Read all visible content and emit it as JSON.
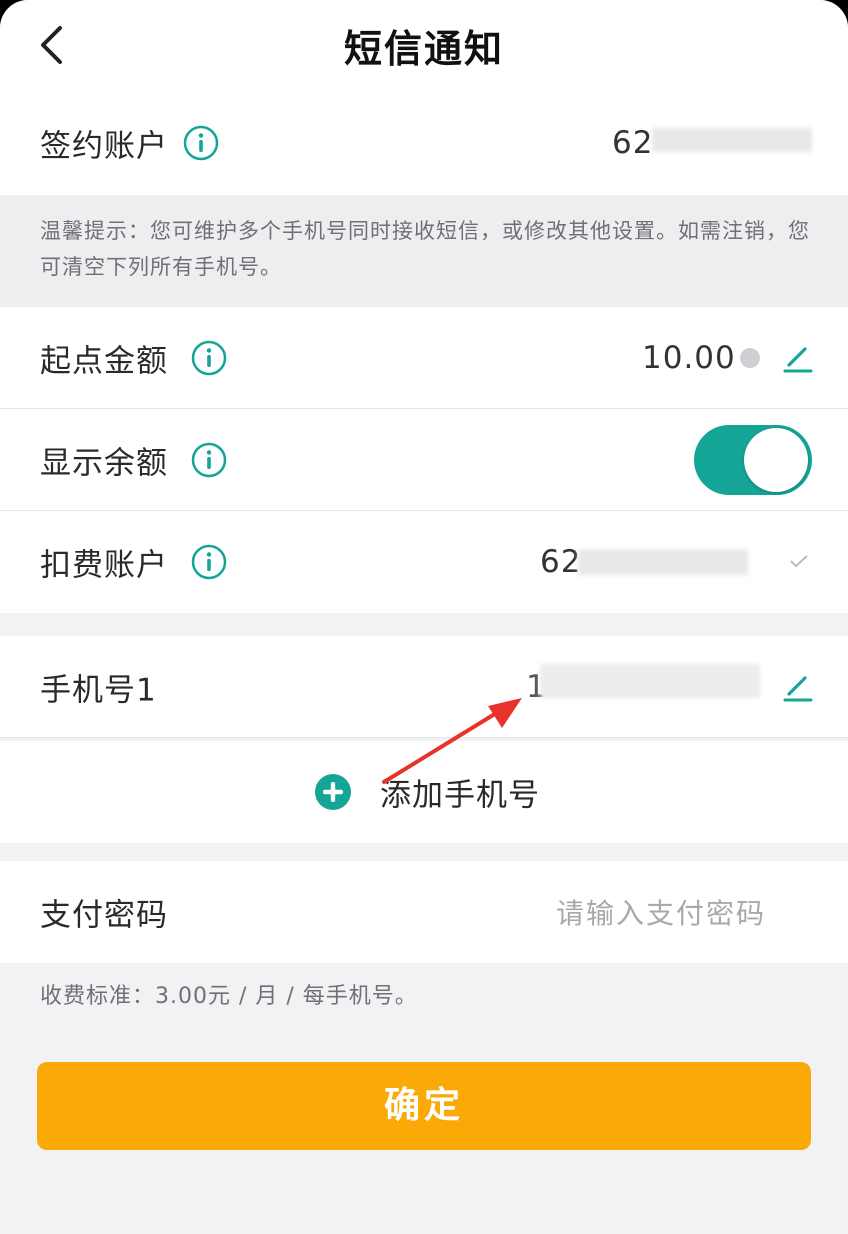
{
  "header": {
    "title": "短信通知"
  },
  "signing_account": {
    "label": "签约账户",
    "value": "62"
  },
  "tip": {
    "text": "温馨提示：您可维护多个手机号同时接收短信，或修改其他设置。如需注销，您可清空下列所有手机号。"
  },
  "threshold": {
    "label": "起点金额",
    "value": "10.00"
  },
  "show_balance": {
    "label": "显示余额",
    "enabled": true
  },
  "debit_account": {
    "label": "扣费账户",
    "value": "62"
  },
  "phone1": {
    "label": "手机号1",
    "value": "1"
  },
  "add_phone": {
    "label": "添加手机号"
  },
  "pay_password": {
    "label": "支付密码",
    "placeholder": "请输入支付密码"
  },
  "fee_note": "收费标准：3.00元 / 月 / 每手机号。",
  "confirm": {
    "label": "确定"
  },
  "colors": {
    "accent": "#15a596",
    "button": "#faa907",
    "arrow": "#e8332c"
  },
  "icons": [
    "back-arrow-icon",
    "info-icon",
    "edit-icon",
    "check-icon",
    "add-circle-icon"
  ]
}
